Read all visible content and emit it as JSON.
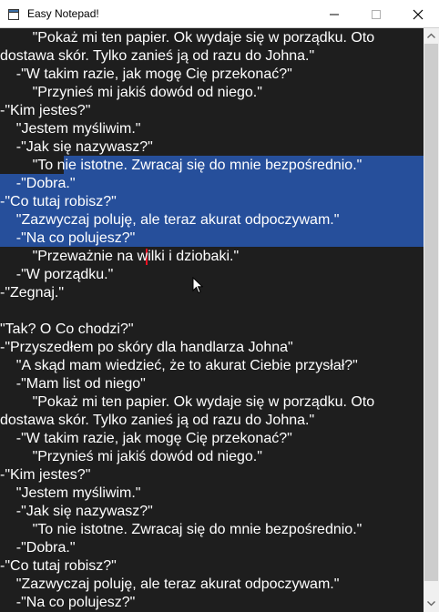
{
  "window": {
    "title": "Easy Notepad!",
    "app_icon": "notepad-window-icon",
    "controls": [
      "minimize-icon",
      "maximize-icon",
      "close-icon"
    ]
  },
  "colors": {
    "editor_background": "#1e1e1e",
    "text": "#ffffff",
    "selection": "#264f9b",
    "caret": "#e81123"
  },
  "editor": {
    "lines": [
      "        \"Pokaż mi ten papier. Ok wydaje się w porządku. Oto",
      "dostawa skór. Tylko zanieś ją od razu do Johna.\"",
      "    -\"W takim razie, jak mogę Cię przekonać?\"",
      "        \"Przynieś mi jakiś dowód od niego.\"",
      "-\"Kim jestes?\"",
      "    \"Jestem myśliwim.\"",
      "    -\"Jak się nazywasz?\"",
      "        \"To nie istotne. Zwracaj się do mnie bezpośrednio.\"",
      "    -\"Dobra.\"",
      "-\"Co tutaj robisz?\"",
      "    \"Zazwyczaj poluję, ale teraz akurat odpoczywam.\"",
      "    -\"Na co polujesz?\"",
      "        \"Przeważnie na wilki i dziobaki.\"",
      "    -\"W porządku.\"",
      "-\"Zegnaj.\"",
      "",
      "\"Tak? O Co chodzi?\"",
      "-\"Przyszedłem po skóry dla handlarza Johna\"",
      "    \"A skąd mam wiedzieć, że to akurat Ciebie przysłał?\"",
      "    -\"Mam list od niego\"",
      "        \"Pokaż mi ten papier. Ok wydaje się w porządku. Oto",
      "dostawa skór. Tylko zanieś ją od razu do Johna.\"",
      "    -\"W takim razie, jak mogę Cię przekonać?\"",
      "        \"Przynieś mi jakiś dowód od niego.\"",
      "-\"Kim jestes?\"",
      "    \"Jestem myśliwim.\"",
      "    -\"Jak się nazywasz?\"",
      "        \"To nie istotne. Zwracaj się do mnie bezpośrednio.\"",
      "    -\"Dobra.\"",
      "-\"Co tutaj robisz?\"",
      "    \"Zazwyczaj poluję, ale teraz akurat odpoczywam.\"",
      "    -\"Na co polujesz?\""
    ]
  },
  "scrollbar": {
    "up_icon": "scroll-up-arrow-icon",
    "down_icon": "scroll-down-arrow-icon"
  },
  "pointer": "mouse-pointer-icon"
}
